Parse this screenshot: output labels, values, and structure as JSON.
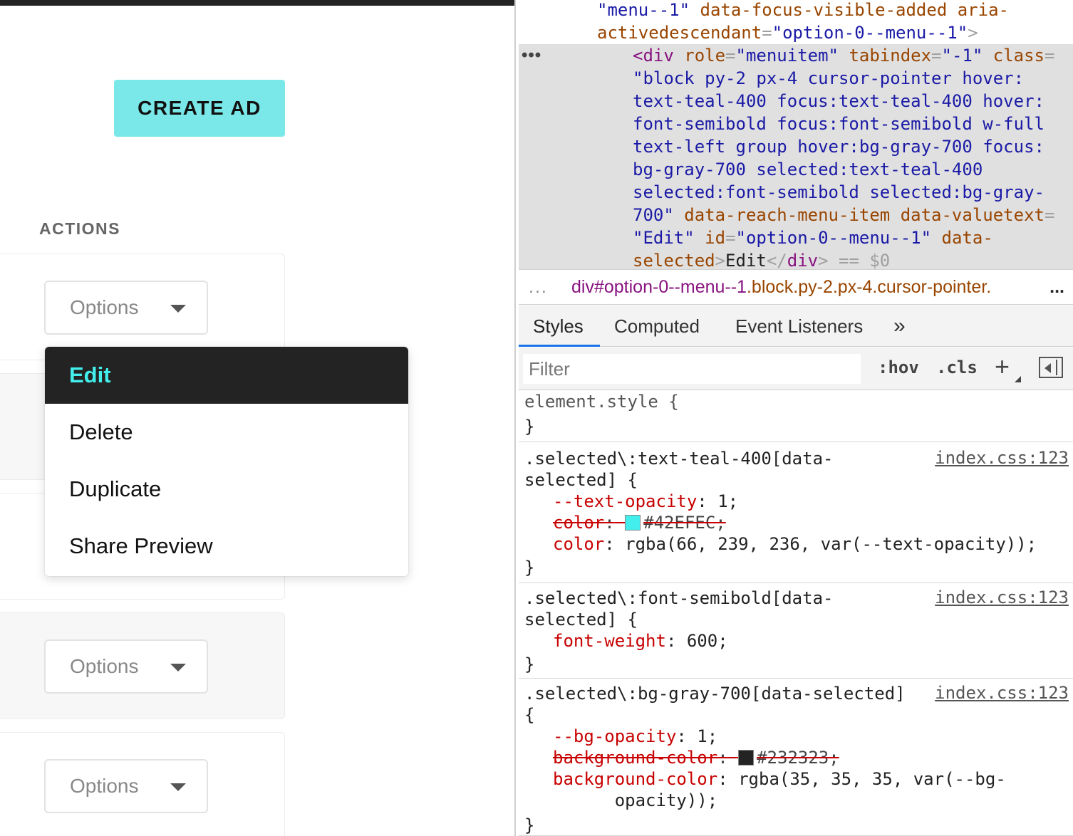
{
  "app": {
    "create_button": "CREATE AD",
    "actions_label": "ACTIONS",
    "options_label": "Options",
    "menu_items": [
      "Edit",
      "Delete",
      "Duplicate",
      "Share Preview"
    ],
    "colors": {
      "accent": "#7ae8e8",
      "selected_text": "#42EFEC",
      "selected_bg": "#232323"
    }
  },
  "devtools": {
    "dom_lines": [
      [
        [
          "val",
          "\"menu--1\""
        ],
        [
          "txt",
          " "
        ],
        [
          "attr",
          "data-focus-visible-added"
        ],
        [
          "txt",
          " "
        ],
        [
          "attr",
          "aria-"
        ]
      ],
      [
        [
          "attr",
          "activedescendant"
        ],
        [
          "punc",
          "="
        ],
        [
          "val",
          "\"option-0--menu--1\""
        ],
        [
          "punc",
          ">"
        ]
      ],
      [
        [
          "tag",
          "<div"
        ],
        [
          "txt",
          " "
        ],
        [
          "attr",
          "role"
        ],
        [
          "punc",
          "="
        ],
        [
          "val",
          "\"menuitem\""
        ],
        [
          "txt",
          " "
        ],
        [
          "attr",
          "tabindex"
        ],
        [
          "punc",
          "="
        ],
        [
          "val",
          "\"-1\""
        ],
        [
          "txt",
          " "
        ],
        [
          "attr",
          "class"
        ],
        [
          "punc",
          "="
        ]
      ],
      [
        [
          "val",
          "\"block py-2 px-4 cursor-pointer hover:"
        ]
      ],
      [
        [
          "val",
          "text-teal-400 focus:text-teal-400 hover:"
        ]
      ],
      [
        [
          "val",
          "font-semibold focus:font-semibold w-full"
        ]
      ],
      [
        [
          "val",
          "text-left group hover:bg-gray-700 focus:"
        ]
      ],
      [
        [
          "val",
          "bg-gray-700 selected:text-teal-400"
        ]
      ],
      [
        [
          "val",
          "selected:font-semibold selected:bg-gray-"
        ]
      ],
      [
        [
          "val",
          "700\""
        ],
        [
          "txt",
          " "
        ],
        [
          "attr",
          "data-reach-menu-item"
        ],
        [
          "txt",
          " "
        ],
        [
          "attr",
          "data-valuetext"
        ],
        [
          "punc",
          "="
        ]
      ],
      [
        [
          "val",
          "\"Edit\""
        ],
        [
          "txt",
          " "
        ],
        [
          "attr",
          "id"
        ],
        [
          "punc",
          "="
        ],
        [
          "val",
          "\"option-0--menu--1\""
        ],
        [
          "txt",
          " "
        ],
        [
          "attr",
          "data-"
        ]
      ],
      [
        [
          "attr",
          "selected"
        ],
        [
          "punc",
          ">"
        ],
        [
          "txt",
          "Edit"
        ],
        [
          "punc",
          "</"
        ],
        [
          "tag",
          "div"
        ],
        [
          "punc",
          ">"
        ],
        [
          "punc",
          " == "
        ],
        [
          "punc",
          "$0"
        ]
      ]
    ],
    "breadcrumb": {
      "more": "...",
      "tag": "div",
      "id": "#option-0--menu--1",
      "classes": ".block.py-2.px-4.cursor-pointer.",
      "end": "..."
    },
    "tabs": [
      "Styles",
      "Computed",
      "Event Listeners",
      "»"
    ],
    "filter_placeholder": "Filter",
    "hov": ":hov",
    "cls": ".cls",
    "plus": "+",
    "element_style": "element.style {",
    "close_brace": "}",
    "rules": [
      {
        "selector": ".selected\\:text-teal-400[data-\nselected] {",
        "source": "index.css:123",
        "decls": [
          {
            "name": "--text-opacity",
            "value": " 1;",
            "struck": false
          },
          {
            "name": "color",
            "value": "#42EFEC;",
            "struck": true,
            "swatch": "#42EFEC"
          },
          {
            "name": "color",
            "value": " rgba(66, 239, 236, var(--text-opacity));",
            "struck": false
          }
        ]
      },
      {
        "selector": ".selected\\:font-semibold[data-\nselected] {",
        "source": "index.css:123",
        "decls": [
          {
            "name": "font-weight",
            "value": " 600;",
            "struck": false
          }
        ]
      },
      {
        "selector": ".selected\\:bg-gray-700[data-selected]\n{",
        "source": "index.css:123",
        "decls": [
          {
            "name": "--bg-opacity",
            "value": " 1;",
            "struck": false
          },
          {
            "name": "background-color",
            "value": "#232323;",
            "struck": true,
            "swatch": "#232323"
          },
          {
            "name": "background-color",
            "value": " rgba(35, 35, 35, var(--bg-\n      opacity));",
            "struck": false
          }
        ]
      }
    ]
  }
}
